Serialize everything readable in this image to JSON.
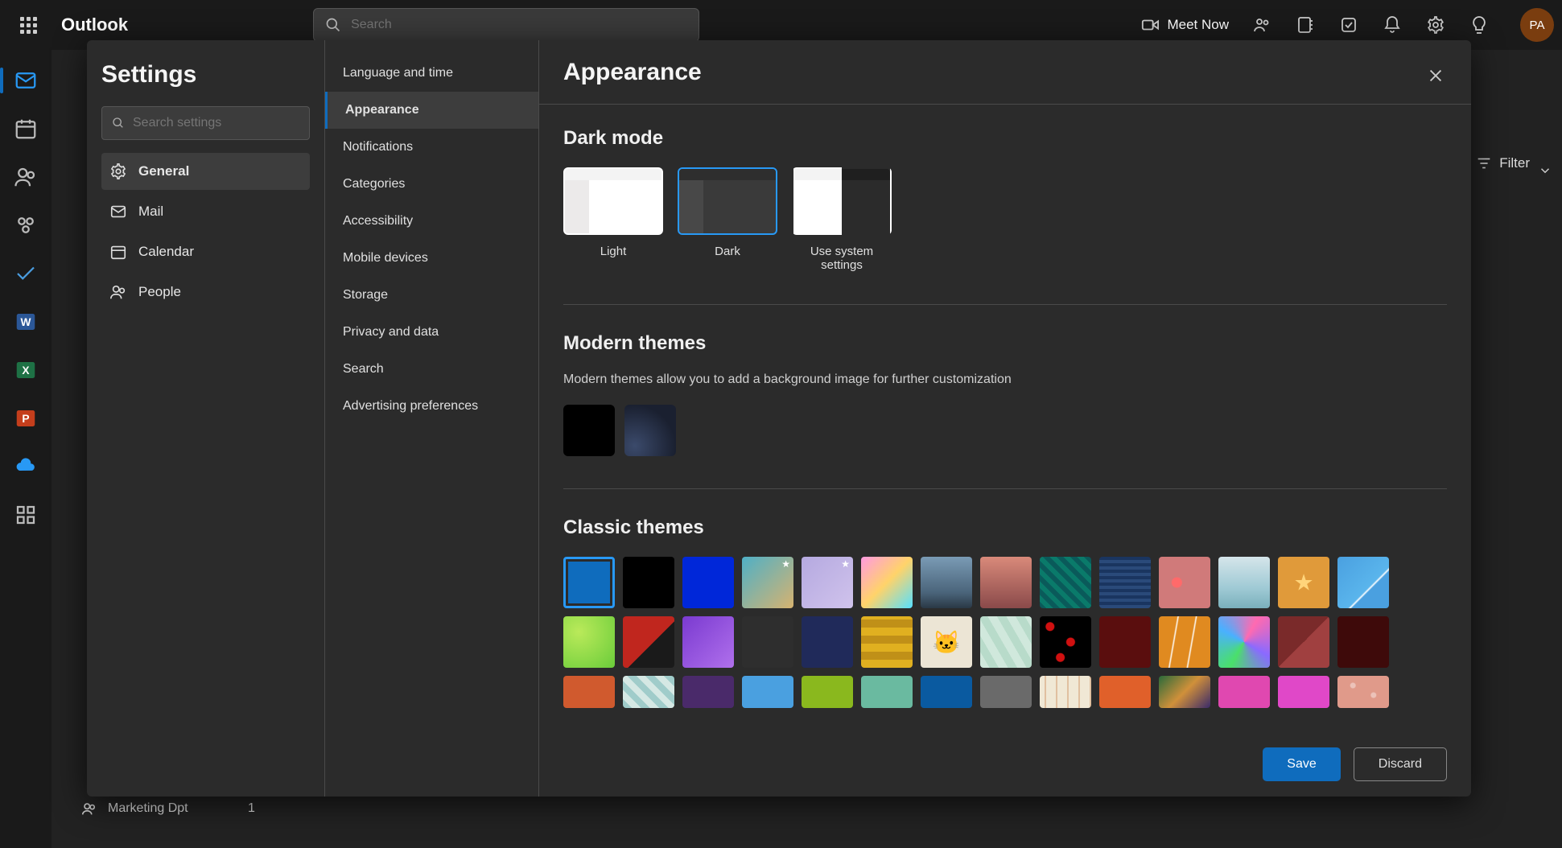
{
  "header": {
    "app_name": "Outlook",
    "search_placeholder": "Search",
    "meet_now": "Meet Now",
    "avatar_initials": "PA"
  },
  "filter_btn": "Filter",
  "bottom_group": {
    "label": "Marketing Dpt",
    "count": "1"
  },
  "dialog": {
    "left_title": "Settings",
    "search_placeholder": "Search settings",
    "categories": [
      {
        "id": "general",
        "label": "General",
        "active": true
      },
      {
        "id": "mail",
        "label": "Mail",
        "active": false
      },
      {
        "id": "calendar",
        "label": "Calendar",
        "active": false
      },
      {
        "id": "people",
        "label": "People",
        "active": false
      }
    ],
    "subnav": [
      {
        "label": "Language and time",
        "active": false
      },
      {
        "label": "Appearance",
        "active": true
      },
      {
        "label": "Notifications",
        "active": false
      },
      {
        "label": "Categories",
        "active": false
      },
      {
        "label": "Accessibility",
        "active": false
      },
      {
        "label": "Mobile devices",
        "active": false
      },
      {
        "label": "Storage",
        "active": false
      },
      {
        "label": "Privacy and data",
        "active": false
      },
      {
        "label": "Search",
        "active": false
      },
      {
        "label": "Advertising preferences",
        "active": false
      }
    ],
    "panel_title": "Appearance",
    "dark_mode": {
      "title": "Dark mode",
      "options": [
        {
          "id": "light",
          "label": "Light",
          "selected": false
        },
        {
          "id": "dark",
          "label": "Dark",
          "selected": true
        },
        {
          "id": "system",
          "label": "Use system settings",
          "selected": false
        }
      ]
    },
    "modern": {
      "title": "Modern themes",
      "desc": "Modern themes allow you to add a background image for further customization"
    },
    "classic": {
      "title": "Classic themes"
    },
    "buttons": {
      "save": "Save",
      "discard": "Discard"
    }
  }
}
